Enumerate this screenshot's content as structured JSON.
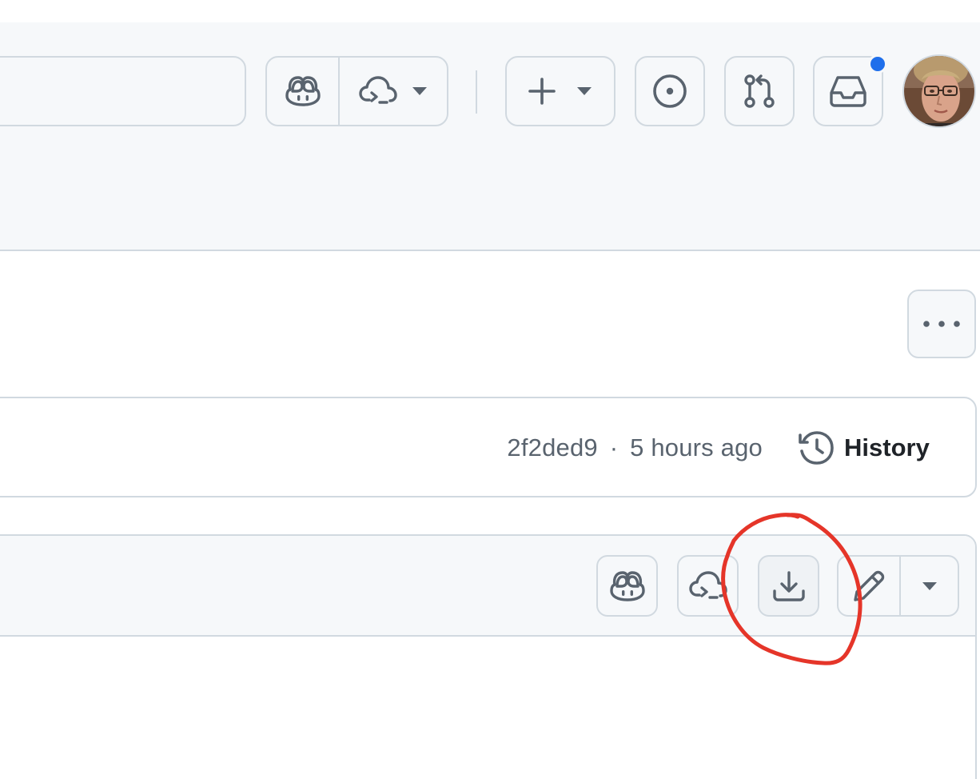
{
  "header": {
    "search": {
      "placeholder": ""
    },
    "copilot_button": {
      "icon": "copilot-icon"
    },
    "codespaces_button": {
      "icon": "cloud-terminal-icon",
      "dropdown_icon": "triangle-down-icon"
    },
    "create_button": {
      "icon": "plus-icon",
      "dropdown_icon": "triangle-down-icon"
    },
    "issues_button": {
      "icon": "issue-opened-icon"
    },
    "pull_requests_button": {
      "icon": "git-pull-request-icon"
    },
    "inbox_button": {
      "icon": "inbox-icon",
      "has_unread": true,
      "unread_color": "#1f6feb"
    },
    "avatar": {
      "icon": "user-avatar"
    }
  },
  "repo_actions": {
    "more_icon": "kebab-horizontal-icon"
  },
  "commit_bar": {
    "commit_hash": "2f2ded9",
    "separator": "·",
    "time_ago": "5 hours ago",
    "history_label": "History",
    "history_icon": "history-icon"
  },
  "file_toolbar": {
    "copilot_icon": "copilot-icon",
    "codespaces_icon": "cloud-terminal-icon",
    "download_icon": "download-icon",
    "edit_icon": "pencil-icon",
    "more_dropdown_icon": "triangle-down-icon",
    "annotation_color": "#e53529"
  },
  "colors": {
    "header_bg": "#f6f8fa",
    "border": "#d1d9e0",
    "icon": "#59636e",
    "text": "#1f2328",
    "muted_text": "#59636e"
  }
}
